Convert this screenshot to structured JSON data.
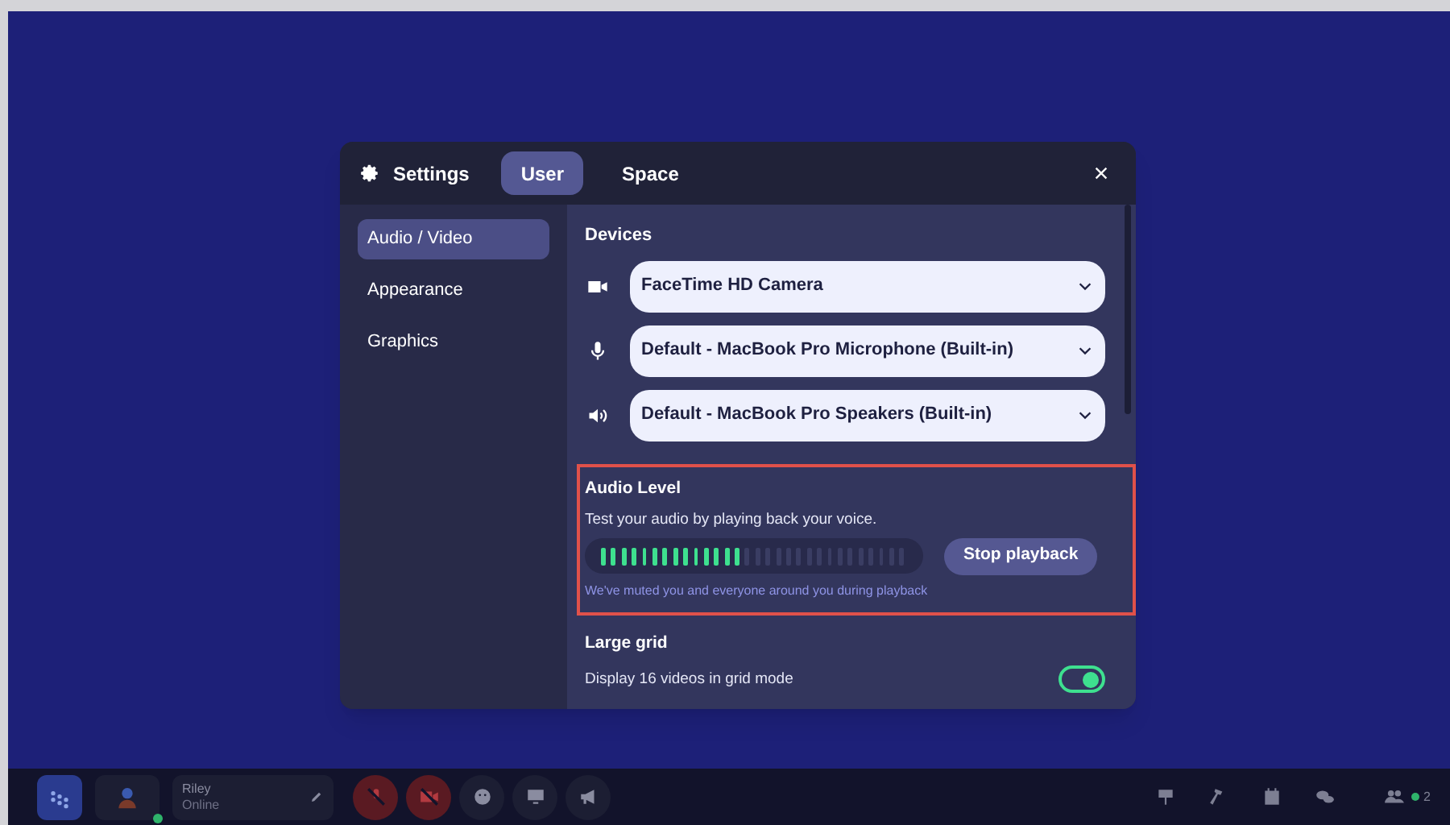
{
  "dialog": {
    "header": {
      "title": "Settings",
      "tabs": [
        {
          "label": "User",
          "selected": true
        },
        {
          "label": "Space",
          "selected": false
        }
      ]
    },
    "sidebar": {
      "items": [
        {
          "label": "Audio / Video",
          "selected": true
        },
        {
          "label": "Appearance",
          "selected": false
        },
        {
          "label": "Graphics",
          "selected": false
        }
      ]
    },
    "devices": {
      "heading": "Devices",
      "selects": [
        {
          "kind": "camera",
          "value": "FaceTime HD Camera"
        },
        {
          "kind": "microphone",
          "value": "Default - MacBook Pro Microphone (Built-in)"
        },
        {
          "kind": "speaker",
          "value": "Default - MacBook Pro Speakers (Built-in)"
        }
      ]
    },
    "audio_level": {
      "highlighted": true,
      "heading": "Audio Level",
      "description": "Test your audio by playing back your voice.",
      "meter": {
        "level": 0.46
      },
      "button": "Stop playback",
      "note": "We've muted you and everyone around you during playback"
    },
    "large_grid": {
      "heading": "Large grid",
      "description": "Display 16 videos in grid mode",
      "on": true
    }
  },
  "bottom_bar": {
    "user": {
      "name": "Riley",
      "status": "Online"
    },
    "left_buttons": [
      {
        "kind": "mic",
        "muted": true
      },
      {
        "kind": "camera",
        "muted": true
      },
      {
        "kind": "emoji",
        "muted": false
      },
      {
        "kind": "screen",
        "muted": false
      },
      {
        "kind": "megaphone",
        "muted": false
      }
    ],
    "right_buttons": [
      {
        "kind": "sign"
      },
      {
        "kind": "hammer"
      },
      {
        "kind": "calendar"
      },
      {
        "kind": "chat"
      }
    ],
    "participants": "2"
  }
}
